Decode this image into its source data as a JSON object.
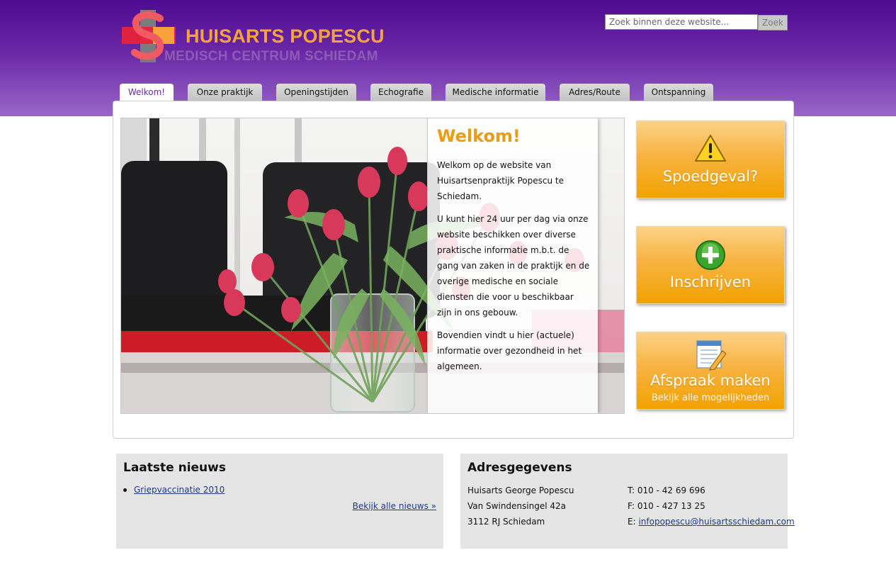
{
  "header": {
    "logo_title": "HUISARTS POPESCU",
    "logo_subtitle": "MEDISCH CENTRUM SCHIEDAM",
    "search_placeholder": "Zoek binnen deze website...",
    "search_button": "Zoek",
    "colors": {
      "purple": "#5a1a9c",
      "orange": "#f6a33b",
      "red": "#e8233a",
      "logo_grey": "#8e5bb5"
    }
  },
  "nav": {
    "tabs": [
      {
        "label": "Welkom!",
        "active": true
      },
      {
        "label": "Onze praktijk",
        "active": false
      },
      {
        "label": "Openingstijden",
        "active": false
      },
      {
        "label": "Echografie",
        "active": false
      },
      {
        "label": "Medische informatie",
        "active": false
      },
      {
        "label": "Adres/Route",
        "active": false
      },
      {
        "label": "Ontspanning",
        "active": false
      }
    ]
  },
  "welcome": {
    "title": "Welkom!",
    "paragraphs": [
      "Welkom op de website van Huisartsenpraktijk Popescu te Schiedam.",
      "U kunt hier 24 uur per dag via onze website beschikken over diverse praktische informatie m.b.t. de gang van zaken in de praktijk en de overige medische en sociale diensten die voor u beschikbaar zijn in ons gebouw.",
      "Bovendien vindt u hier (actuele) informatie over gezondheid in het algemeen."
    ]
  },
  "actions": [
    {
      "label": "Spoedgeval?",
      "icon": "warning-icon",
      "sublabel": ""
    },
    {
      "label": "Inschrijven",
      "icon": "plus-circle-icon",
      "sublabel": ""
    },
    {
      "label": "Afspraak maken",
      "icon": "notepad-pencil-icon",
      "sublabel": "Bekijk alle mogelijkheden"
    }
  ],
  "news": {
    "title": "Laatste nieuws",
    "items": [
      "Griepvaccinatie 2010"
    ],
    "more_link": "Bekijk alle nieuws »"
  },
  "address": {
    "title": "Adresgegevens",
    "lines": [
      "Huisarts George Popescu",
      "Van Swindensingel 42a",
      "3112 RJ Schiedam"
    ],
    "phone": "T: 010 - 42 69 696",
    "fax": "F: 010 - 427 13 25",
    "email_prefix": "E: ",
    "email": "infopopescu@huisartsschiedam.com"
  }
}
